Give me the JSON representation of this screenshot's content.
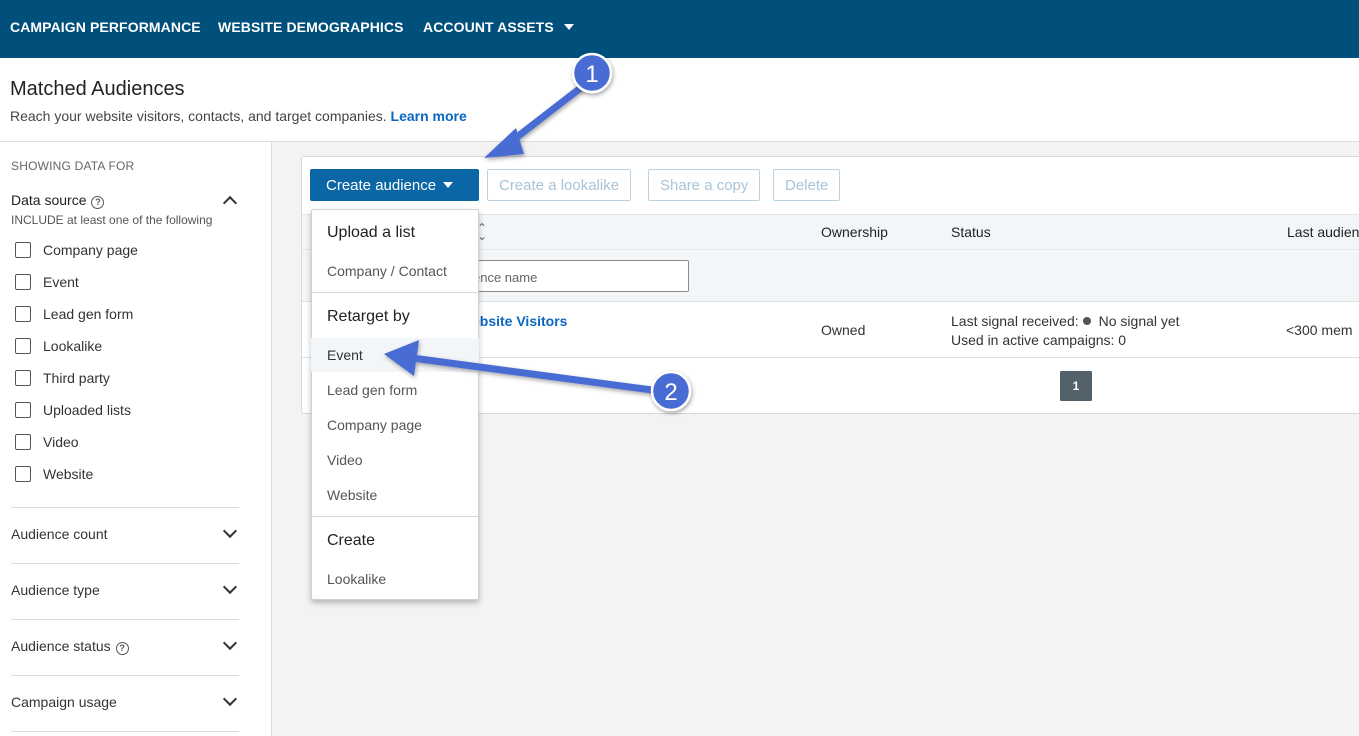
{
  "nav": {
    "items": [
      "CAMPAIGN PERFORMANCE",
      "WEBSITE DEMOGRAPHICS",
      "ACCOUNT ASSETS"
    ]
  },
  "header": {
    "title": "Matched Audiences",
    "subtitle": "Reach your website visitors, contacts, and target companies.",
    "learn_more": "Learn more"
  },
  "sidebar": {
    "showing": "SHOWING DATA FOR",
    "data_source_title": "Data source",
    "include_text": "INCLUDE at least one of the following",
    "data_sources": [
      "Company page",
      "Event",
      "Lead gen form",
      "Lookalike",
      "Third party",
      "Uploaded lists",
      "Video",
      "Website"
    ],
    "filters": [
      "Audience count",
      "Audience type",
      "Audience status",
      "Campaign usage"
    ]
  },
  "toolbar": {
    "create_audience": "Create audience",
    "create_lookalike": "Create a lookalike",
    "share_copy": "Share a copy",
    "delete": "Delete"
  },
  "table": {
    "columns": {
      "ownership": "Ownership",
      "status": "Status",
      "last_audience": "Last audien"
    },
    "filter_placeholder": "ence name",
    "rows": [
      {
        "name": "ebsite Visitors",
        "ownership": "Owned",
        "last_signal_label": "Last signal received:",
        "last_signal_value": "No signal yet",
        "used_in": "Used in active campaigns: 0",
        "last_audience": "<300 mem"
      }
    ],
    "page": "1"
  },
  "dropdown": {
    "upload_heading": "Upload a list",
    "upload_items": [
      "Company / Contact"
    ],
    "retarget_heading": "Retarget by",
    "retarget_items": [
      "Event",
      "Lead gen form",
      "Company page",
      "Video",
      "Website"
    ],
    "create_heading": "Create",
    "create_items": [
      "Lookalike"
    ]
  },
  "annotations": {
    "badge1": "1",
    "badge2": "2",
    "color": "#4a6cd4"
  }
}
